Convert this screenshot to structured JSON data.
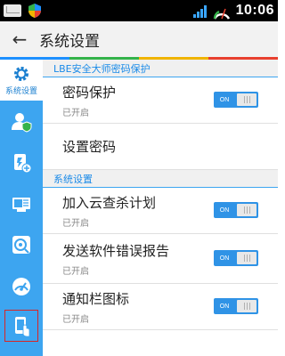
{
  "status_bar": {
    "time": "10:06",
    "battery_level": "36"
  },
  "header": {
    "back_label": "←",
    "title": "系统设置"
  },
  "accent_colors": [
    "#1e90ff",
    "#34b34a",
    "#f0b400",
    "#e8402f"
  ],
  "sidebar": {
    "items": [
      {
        "label": "系统设置",
        "icon": "gear-icon",
        "active": true
      },
      {
        "icon": "user-shield-icon"
      },
      {
        "icon": "app-add-icon"
      },
      {
        "icon": "device-manager-icon"
      },
      {
        "icon": "disk-cleaner-icon"
      },
      {
        "icon": "speedometer-icon"
      },
      {
        "icon": "phone-touch-icon"
      }
    ]
  },
  "sections": [
    {
      "header": "LBE安全大师密码保护",
      "rows": [
        {
          "title": "密码保护",
          "subtitle": "已开启",
          "toggle": "ON"
        },
        {
          "title": "设置密码"
        }
      ]
    },
    {
      "header": "系统设置",
      "rows": [
        {
          "title": "加入云查杀计划",
          "subtitle": "已开启",
          "toggle": "ON"
        },
        {
          "title": "发送软件错误报告",
          "subtitle": "已开启",
          "toggle": "ON"
        },
        {
          "title": "通知栏图标",
          "subtitle": "已开启",
          "toggle": "ON"
        }
      ]
    }
  ]
}
